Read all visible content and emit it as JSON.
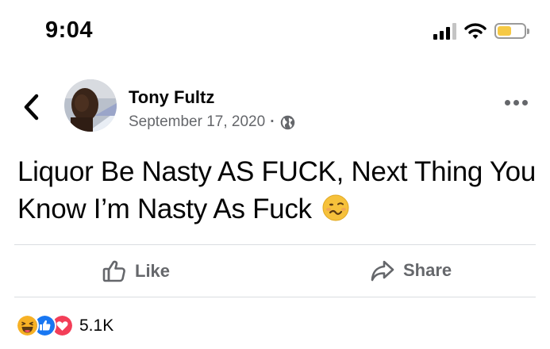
{
  "status_bar": {
    "time": "9:04",
    "icons": [
      "signal-icon",
      "wifi-icon",
      "battery-icon"
    ],
    "battery_level": 0.48,
    "battery_color": "#f6c945"
  },
  "post": {
    "author": "Tony Fultz",
    "date": "September 17, 2020",
    "separator": "·",
    "privacy_icon": "globe-icon",
    "text": "Liquor Be Nasty AS FUCK, Next Thing You Know I’m Nasty As Fuck",
    "text_emoji": "woozy-face-icon"
  },
  "actions": {
    "like_label": "Like",
    "share_label": "Share"
  },
  "reactions": {
    "icons": [
      "haha-icon",
      "like-icon",
      "love-icon"
    ],
    "count": "5.1K"
  },
  "colors": {
    "like_blue": "#1877f2",
    "love_red": "#f33e58",
    "haha_yellow": "#f7b125",
    "secondary_text": "#65676b"
  }
}
